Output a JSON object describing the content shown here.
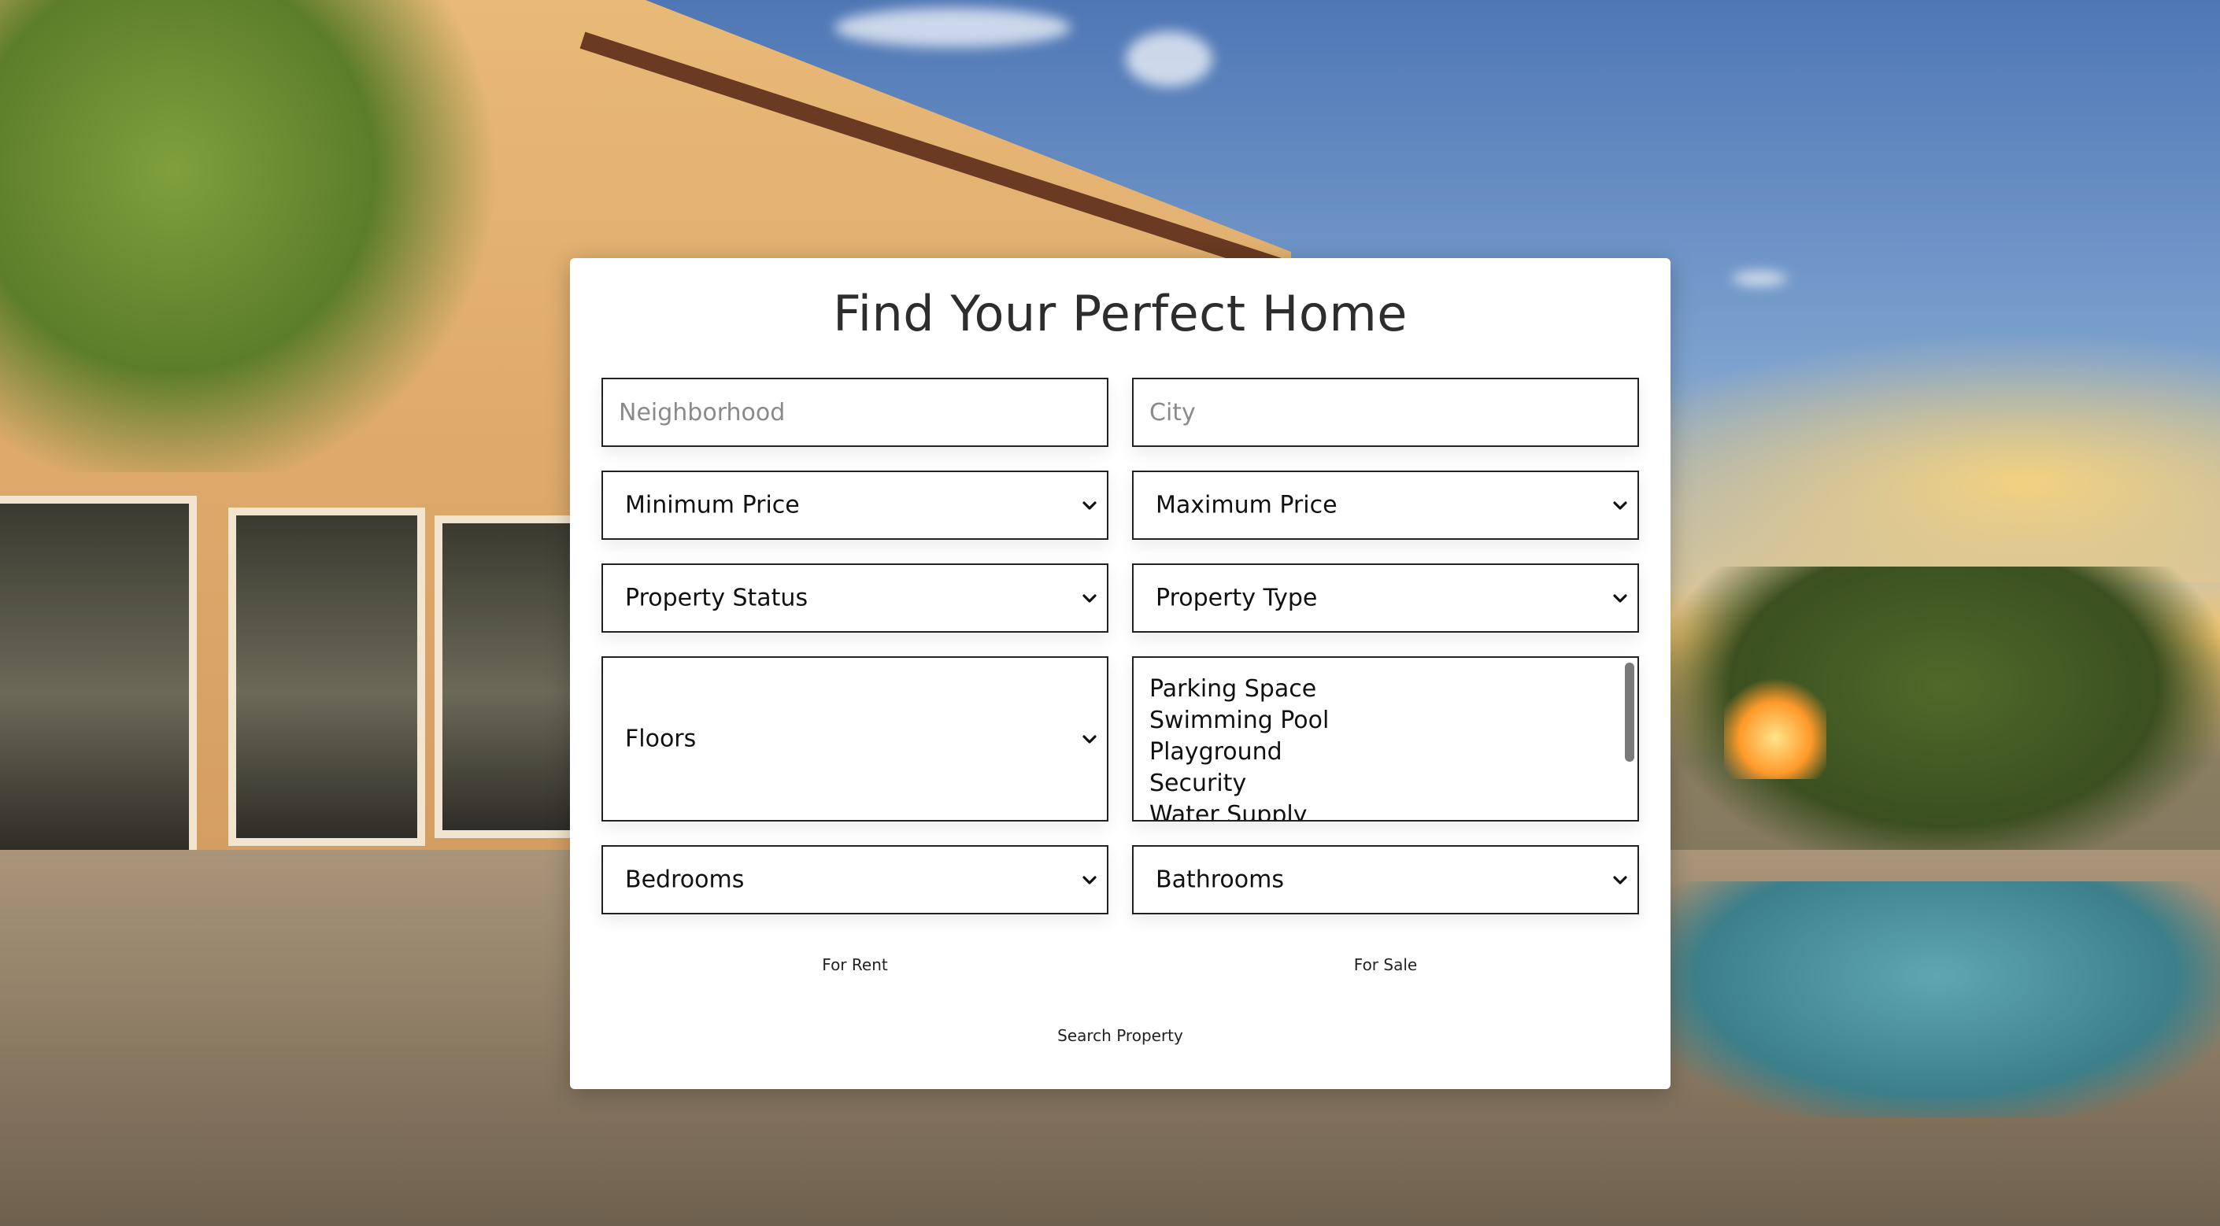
{
  "page": {
    "title": "Find Your Perfect Home"
  },
  "form": {
    "neighborhood_placeholder": "Neighborhood",
    "city_placeholder": "City",
    "min_price": {
      "selected": "Minimum Price"
    },
    "max_price": {
      "selected": "Maximum Price"
    },
    "property_status": {
      "selected": "Property Status"
    },
    "property_type": {
      "selected": "Property Type"
    },
    "floors": {
      "selected": "Floors"
    },
    "features": {
      "options": [
        "Parking Space",
        "Swimming Pool",
        "Playground",
        "Security",
        "Water Supply"
      ]
    },
    "bedrooms": {
      "selected": "Bedrooms"
    },
    "bathrooms": {
      "selected": "Bathrooms"
    },
    "for_rent_label": "For Rent",
    "for_sale_label": "For Sale",
    "search_label": "Search Property"
  },
  "icons": {
    "select_chevron": "chevron-down-icon"
  },
  "colors": {
    "card_background": "#ffffff",
    "border": "#222222",
    "title_text": "#2d2d2d",
    "placeholder_text": "#8a8a8a"
  }
}
